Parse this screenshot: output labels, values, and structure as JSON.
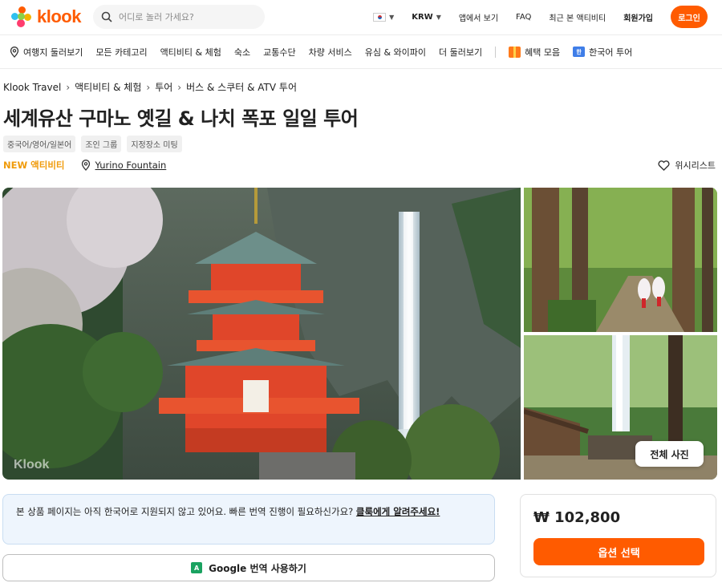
{
  "header": {
    "brand": "klook",
    "search_placeholder": "어디로 놀러 가세요?",
    "currency": "KRW",
    "links": [
      "앱에서 보기",
      "FAQ",
      "최근 본 액티비티",
      "회원가입"
    ],
    "login_label": "로그인"
  },
  "nav": {
    "items": [
      "여행지 둘러보기",
      "모든 카테고리",
      "액티비티 & 체험",
      "숙소",
      "교통수단",
      "차량 서비스",
      "유심 & 와이파이",
      "더 둘러보기"
    ],
    "promo": "혜택 모음",
    "korean_tour": "한국어 투어"
  },
  "breadcrumb": [
    "Klook Travel",
    "액티비티 & 체험",
    "투어",
    "버스 & 스쿠터 & ATV 투어"
  ],
  "product": {
    "title": "세계유산 구마노 옛길 & 나치 폭포 일일 투어",
    "tags": [
      "중국어/영어/일본어",
      "조인 그룹",
      "지정장소 미팅"
    ],
    "badge": "NEW 액티비티",
    "location": "Yurino Fountain",
    "wishlist": "위시리스트"
  },
  "gallery": {
    "watermark": "Klook",
    "all_photos": "전체 사진"
  },
  "notice": {
    "text": "본 상품 페이지는 아직 한국어로 지원되지 않고 있어요. 빠른 번역 진행이 필요하신가요? ",
    "link": "클룩에게 알려주세요!",
    "google_translate": "Google 번역 사용하기"
  },
  "booking": {
    "price": "₩ 102,800",
    "select_option": "옵션 선택"
  },
  "colors": {
    "brand": "#ff5b00",
    "new_badge": "#f09b0a",
    "notice_bg": "#eef5fd"
  }
}
